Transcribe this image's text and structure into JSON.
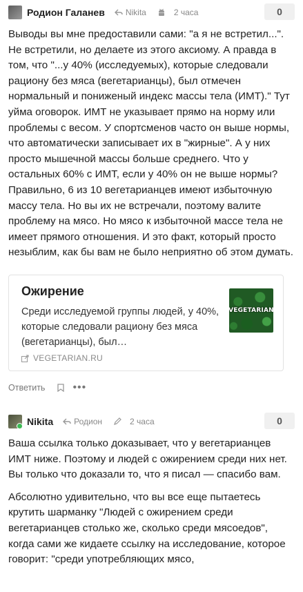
{
  "comments": [
    {
      "author": "Родион Галанев",
      "reply_to": "Nikita",
      "time": "2 часа",
      "score": "0",
      "text": "Выводы вы мне предоставили сами: \"а я не встретил...\". Не встретили, но делаете из этого аксиому. А правда в том, что \"...у 40% (исследуемых), которые следовали рациону без мяса (вегетарианцы), был отмечен нормальный и пониженый индекс массы тела (ИМТ).\" Тут уйма оговорок. ИМТ не указывает прямо на норму или проблемы с весом. У спортсменов часто он выше нормы, что автоматически записывает их в \"жирные\". А у них просто мышечной массы больше среднего. Что у остальных 60% с ИМТ, если у 40% он не выше нормы? Правильно, 6 из 10 вегетарианцев имеют избыточную массу тела. Но вы их не встречали, поэтому валите проблему на мясо. Но мясо к избыточной массе тела не имеет прямого отношения. И это факт, который просто незыблим, как бы вам не было неприятно об этом думать.",
      "link_card": {
        "title": "Ожирение",
        "description": "Среди исследуемой группы людей, у 40%, которые следовали рациону без мяса (вегетарианцы), был…",
        "domain": "VEGETARIAN.RU",
        "thumb_label": "VEGETARIAN"
      },
      "actions": {
        "reply": "Ответить",
        "more": "•••"
      }
    },
    {
      "author": "Nikita",
      "reply_to": "Родион",
      "time": "2 часа",
      "score": "0",
      "paragraphs": [
        "Ваша ссылка только доказывает, что у вегетарианцев ИМТ ниже. Поэтому и людей с ожирением среди них нет. Вы только что доказали то, что я писал — спасибо вам.",
        "Абсолютно удивительно, что вы все еще пытаетесь крутить шарманку \"Людей с ожирением среди вегетарианцев столько же, сколько среди мясоедов\", когда сами же кидаете ссылку на исследование, которое говорит: \"среди употребляющих мясо,"
      ]
    }
  ],
  "colors": {
    "text": "#222222",
    "muted": "#888888",
    "score_bg": "#f0f0f0",
    "online": "#3cba54"
  },
  "icons": [
    "reply-arrow-icon",
    "android-icon",
    "bookmark-icon",
    "pencil-icon",
    "external-link-icon"
  ]
}
